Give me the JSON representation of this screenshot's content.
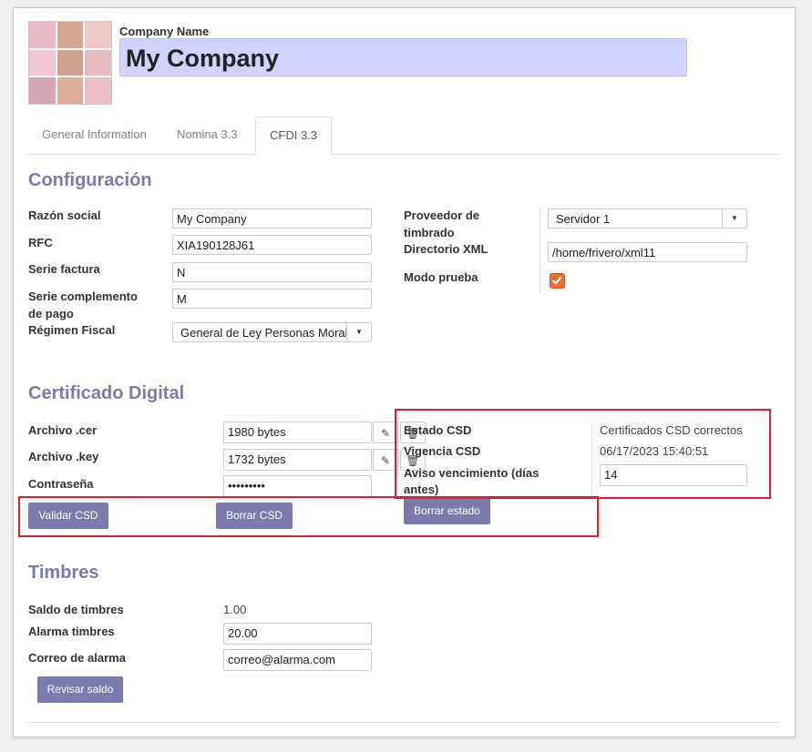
{
  "header": {
    "company_name_label": "Company Name",
    "company_name_value": "My Company"
  },
  "tabs": [
    {
      "label": "General Information"
    },
    {
      "label": "Nomina 3.3"
    },
    {
      "label": "CFDI 3.3"
    }
  ],
  "configuracion": {
    "title": "Configuración",
    "razon_social": {
      "label": "Razón social",
      "value": "My Company"
    },
    "rfc": {
      "label": "RFC",
      "value": "XIA190128J61"
    },
    "serie_factura": {
      "label": "Serie factura",
      "value": "N"
    },
    "serie_complemento": {
      "label_1": "Serie complemento",
      "label_2": "de pago",
      "value": "M"
    },
    "regimen_fiscal": {
      "label": "Régimen Fiscal",
      "value": "General de Ley Personas Moral"
    },
    "proveedor": {
      "label_1": "Proveedor de",
      "label_2": "timbrado",
      "value": "Servidor 1"
    },
    "directorio_xml": {
      "label": "Directorio XML",
      "value": "/home/frivero/xml11"
    },
    "modo_prueba": {
      "label": "Modo prueba",
      "checked": true
    }
  },
  "certificado": {
    "title": "Certificado Digital",
    "archivo_cer": {
      "label": "Archivo .cer",
      "value": "1980 bytes"
    },
    "archivo_key": {
      "label": "Archivo .key",
      "value": "1732 bytes"
    },
    "contrasena": {
      "label": "Contraseña",
      "value": "•••••••••"
    },
    "estado_csd": {
      "label": "Estado CSD",
      "value": "Certificados CSD correctos"
    },
    "vigencia_csd": {
      "label": "Vigencia CSD",
      "value": "06/17/2023 15:40:51"
    },
    "aviso": {
      "label_1": "Aviso vencimiento (días",
      "label_2": "antes)",
      "value": "14"
    },
    "buttons": {
      "validar": "Validar CSD",
      "borrar_csd": "Borrar CSD",
      "borrar_estado": "Borrar estado"
    }
  },
  "timbres": {
    "title": "Timbres",
    "saldo": {
      "label": "Saldo de timbres",
      "value": "1.00"
    },
    "alarma": {
      "label": "Alarma timbres",
      "value": "20.00"
    },
    "correo": {
      "label": "Correo de alarma",
      "value": "correo@alarma.com"
    },
    "revisar_button": "Revisar saldo"
  },
  "colors": {
    "accent": "#7c7bad",
    "name_field_bg": "#d2d2ff",
    "checkbox": "#e4722e",
    "highlight_box": "#d9232a"
  },
  "icons": {
    "edit": "pencil-icon",
    "delete": "trash-icon",
    "dropdown": "caret-down-icon",
    "check": "checkmark-icon"
  }
}
